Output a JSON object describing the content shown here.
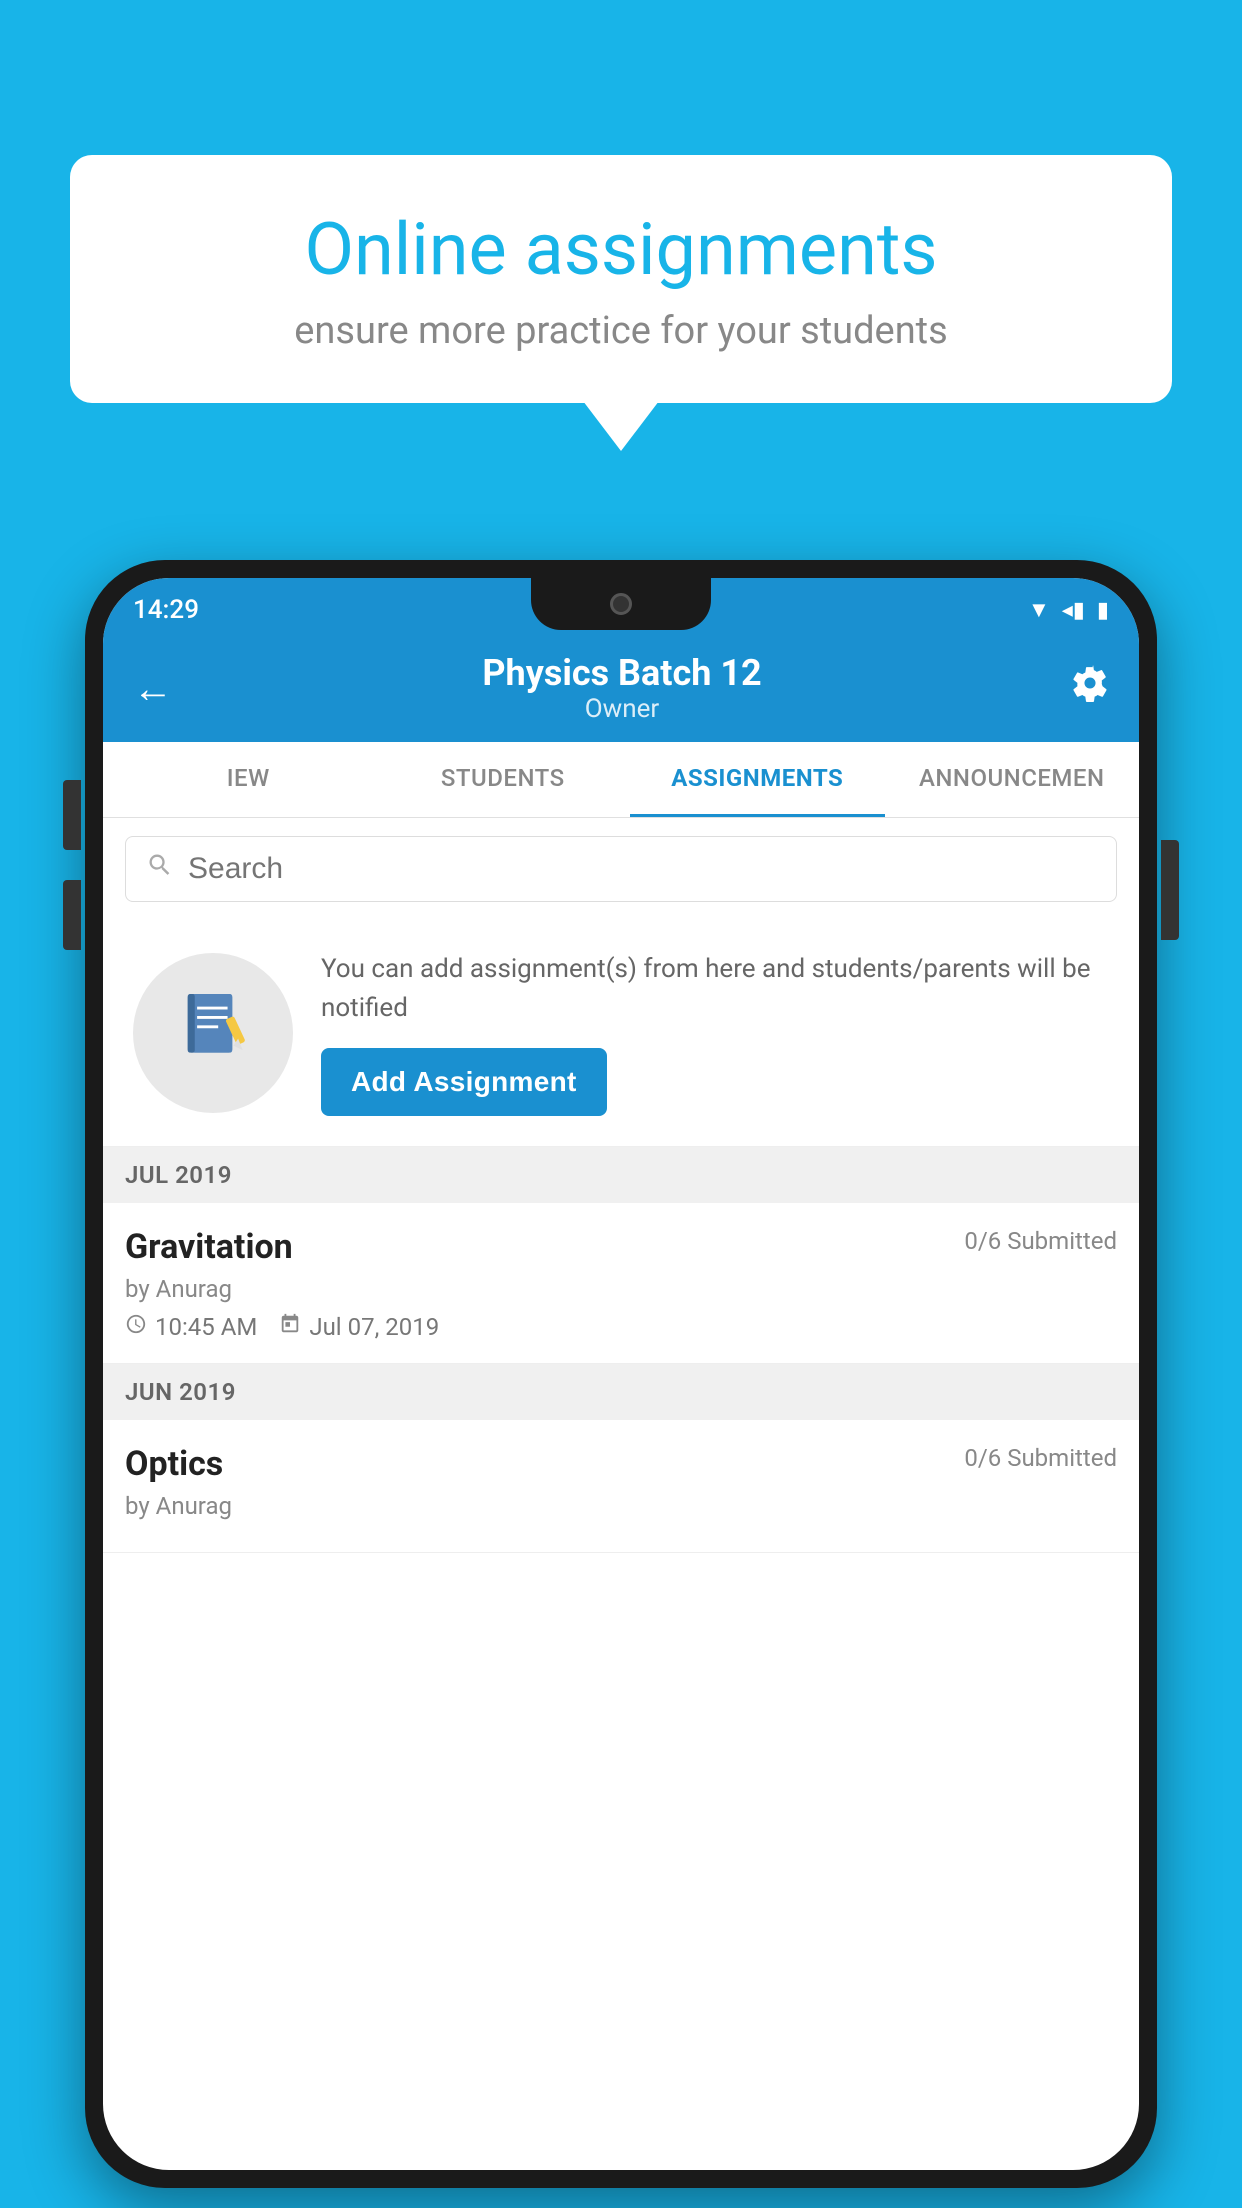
{
  "background_color": "#18b4e8",
  "speech_bubble": {
    "heading": "Online assignments",
    "subtext": "ensure more practice for your students"
  },
  "phone": {
    "status_bar": {
      "time": "14:29",
      "icons": [
        "▼",
        "◀",
        "▮"
      ]
    },
    "header": {
      "title": "Physics Batch 12",
      "subtitle": "Owner",
      "back_label": "←",
      "settings_label": "⚙"
    },
    "tabs": [
      {
        "label": "IEW",
        "active": false
      },
      {
        "label": "STUDENTS",
        "active": false
      },
      {
        "label": "ASSIGNMENTS",
        "active": true
      },
      {
        "label": "ANNOUNCEMEN",
        "active": false
      }
    ],
    "search": {
      "placeholder": "Search"
    },
    "promo_card": {
      "text": "You can add assignment(s) from here and students/parents will be notified",
      "button_label": "Add Assignment"
    },
    "month_sections": [
      {
        "month_label": "JUL 2019",
        "assignments": [
          {
            "name": "Gravitation",
            "submitted": "0/6 Submitted",
            "by": "by Anurag",
            "time": "10:45 AM",
            "date": "Jul 07, 2019"
          }
        ]
      },
      {
        "month_label": "JUN 2019",
        "assignments": [
          {
            "name": "Optics",
            "submitted": "0/6 Submitted",
            "by": "by Anurag",
            "time": "",
            "date": ""
          }
        ]
      }
    ]
  }
}
